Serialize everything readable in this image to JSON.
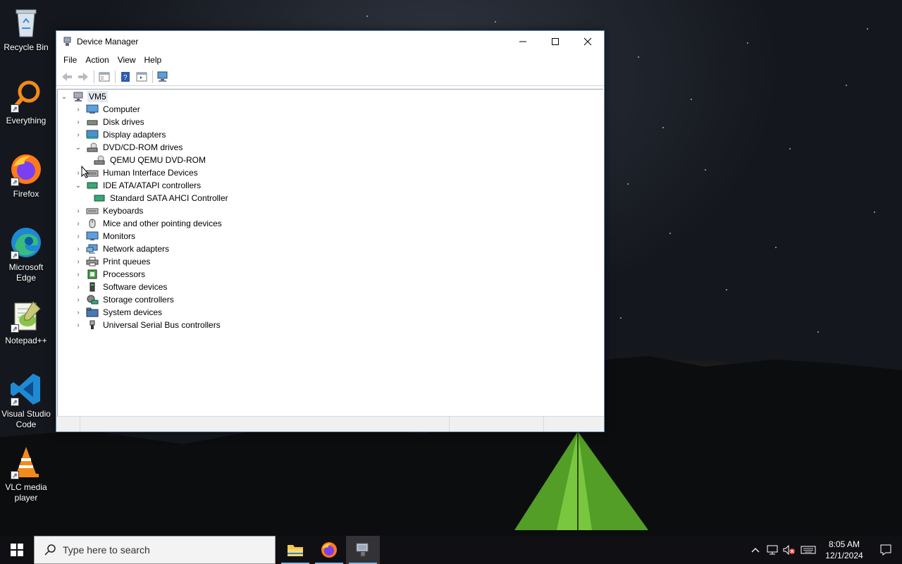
{
  "desktop": {
    "icons": [
      {
        "label": "Recycle Bin",
        "icon": "recycle-bin-icon"
      },
      {
        "label": "Everything",
        "icon": "everything-search-icon"
      },
      {
        "label": "Firefox",
        "icon": "firefox-icon"
      },
      {
        "label": "Microsoft Edge",
        "icon": "edge-icon"
      },
      {
        "label": "Notepad++",
        "icon": "notepadpp-icon"
      },
      {
        "label": "Visual Studio Code",
        "icon": "vscode-icon"
      },
      {
        "label": "VLC media player",
        "icon": "vlc-icon"
      }
    ]
  },
  "window": {
    "title": "Device Manager",
    "menu": [
      "File",
      "Action",
      "View",
      "Help"
    ],
    "tree": {
      "root": "VM5",
      "items": [
        {
          "label": "Computer",
          "expanded": false
        },
        {
          "label": "Disk drives",
          "expanded": false
        },
        {
          "label": "Display adapters",
          "expanded": false
        },
        {
          "label": "DVD/CD-ROM drives",
          "expanded": true,
          "children": [
            "QEMU QEMU DVD-ROM"
          ]
        },
        {
          "label": "Human Interface Devices",
          "expanded": false
        },
        {
          "label": "IDE ATA/ATAPI controllers",
          "expanded": true,
          "children": [
            "Standard SATA AHCI Controller"
          ]
        },
        {
          "label": "Keyboards",
          "expanded": false
        },
        {
          "label": "Mice and other pointing devices",
          "expanded": false
        },
        {
          "label": "Monitors",
          "expanded": false
        },
        {
          "label": "Network adapters",
          "expanded": false
        },
        {
          "label": "Print queues",
          "expanded": false
        },
        {
          "label": "Processors",
          "expanded": false
        },
        {
          "label": "Software devices",
          "expanded": false
        },
        {
          "label": "Storage controllers",
          "expanded": false
        },
        {
          "label": "System devices",
          "expanded": false
        },
        {
          "label": "Universal Serial Bus controllers",
          "expanded": false
        }
      ]
    }
  },
  "taskbar": {
    "search_placeholder": "Type here to search",
    "time": "8:05 AM",
    "date": "12/1/2024",
    "pinned": [
      "file-explorer-icon",
      "firefox-icon",
      "device-manager-icon"
    ]
  }
}
